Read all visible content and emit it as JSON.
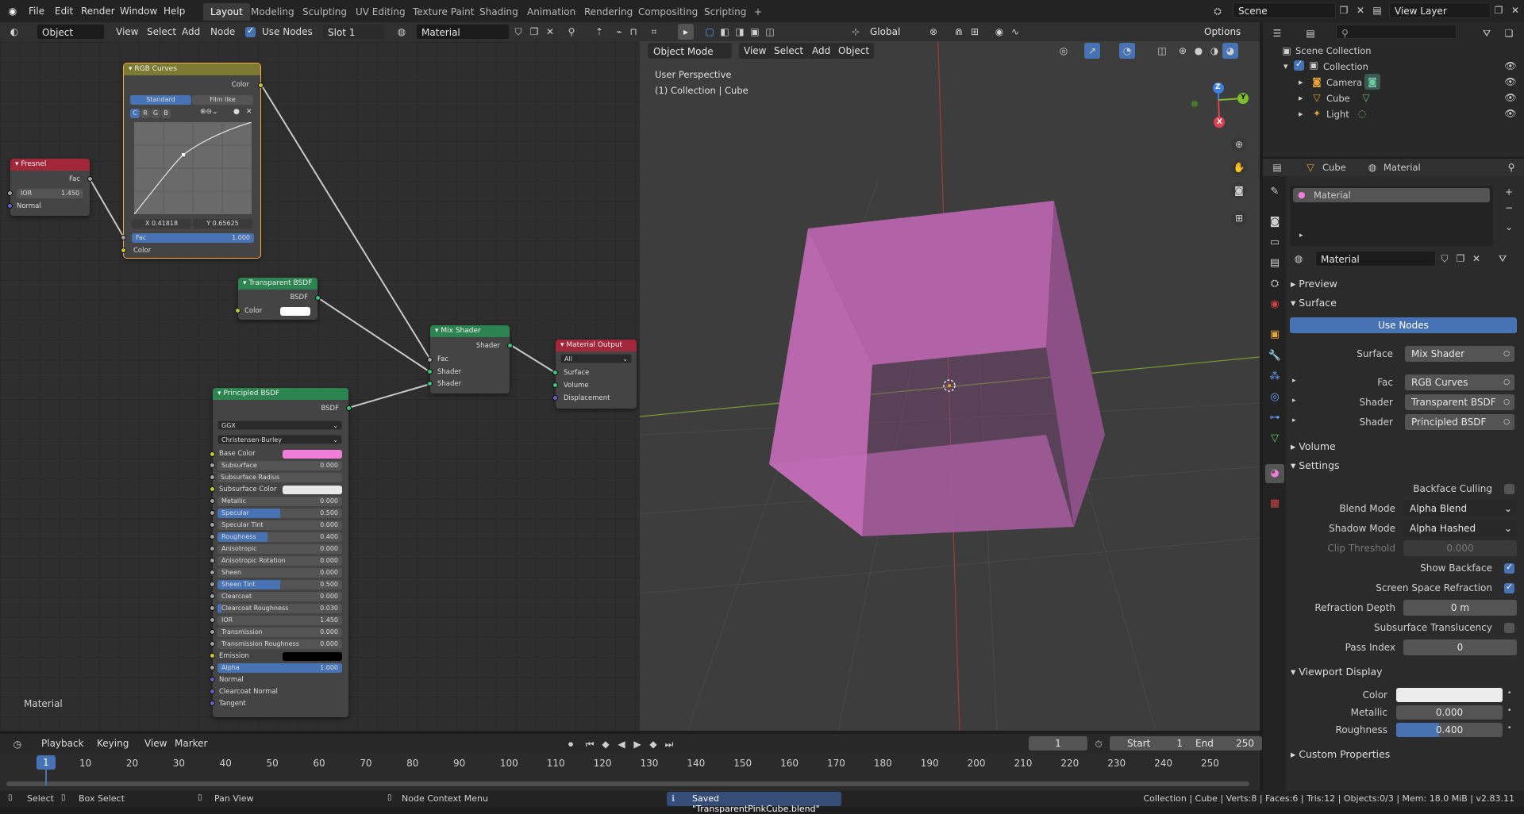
{
  "topbar": {
    "menus": [
      "File",
      "Edit",
      "Render",
      "Window",
      "Help"
    ],
    "workspaces": [
      "Layout",
      "Modeling",
      "Sculpting",
      "UV Editing",
      "Texture Paint",
      "Shading",
      "Animation",
      "Rendering",
      "Compositing",
      "Scripting"
    ],
    "active_workspace": "Layout",
    "add_tab": "+",
    "scene": "Scene",
    "view_layer": "View Layer"
  },
  "node_editor": {
    "header": {
      "mode": "Object",
      "view": "View",
      "select": "Select",
      "add": "Add",
      "node": "Node",
      "use_nodes": "Use Nodes",
      "slot": "Slot 1",
      "material": "Material"
    },
    "footer_label": "Material",
    "nodes": {
      "rgb_curves": {
        "title": "RGB Curves",
        "output": "Color",
        "tab_standard": "Standard",
        "tab_filmlike": "Film like",
        "channels": [
          "C",
          "R",
          "G",
          "B"
        ],
        "x_readout": "X 0.41818",
        "y_readout": "Y 0.65625",
        "fac_label": "Fac",
        "fac_value": "1.000",
        "input": "Color"
      },
      "fresnel": {
        "title": "Fresnel",
        "output": "Fac",
        "ior_label": "IOR",
        "ior_value": "1.450",
        "input": "Normal"
      },
      "transparent": {
        "title": "Transparent BSDF",
        "output": "BSDF",
        "color_label": "Color",
        "color": "#ffffff"
      },
      "mix": {
        "title": "Mix Shader",
        "output": "Shader",
        "inputs": [
          "Fac",
          "Shader",
          "Shader"
        ]
      },
      "output": {
        "title": "Material Output",
        "target": "All",
        "inputs": [
          "Surface",
          "Volume",
          "Displacement"
        ]
      },
      "principled": {
        "title": "Principled BSDF",
        "output": "BSDF",
        "distribution": "GGX",
        "subsurface_method": "Christensen-Burley",
        "base_color_label": "Base Color",
        "base_color": "#f07ed8",
        "fields": [
          {
            "label": "Subsurface",
            "value": "0.000",
            "frac": 0
          },
          {
            "label": "Subsurface Radius",
            "value": "",
            "frac": 0,
            "dropdown": true
          },
          {
            "label": "Subsurface Color",
            "value": "",
            "frac": 0,
            "color": "#e8e8e8"
          },
          {
            "label": "Metallic",
            "value": "0.000",
            "frac": 0
          },
          {
            "label": "Specular",
            "value": "0.500",
            "frac": 0.5
          },
          {
            "label": "Specular Tint",
            "value": "0.000",
            "frac": 0
          },
          {
            "label": "Roughness",
            "value": "0.400",
            "frac": 0.4
          },
          {
            "label": "Anisotropic",
            "value": "0.000",
            "frac": 0
          },
          {
            "label": "Anisotropic Rotation",
            "value": "0.000",
            "frac": 0
          },
          {
            "label": "Sheen",
            "value": "0.000",
            "frac": 0
          },
          {
            "label": "Sheen Tint",
            "value": "0.500",
            "frac": 0.5
          },
          {
            "label": "Clearcoat",
            "value": "0.000",
            "frac": 0
          },
          {
            "label": "Clearcoat Roughness",
            "value": "0.030",
            "frac": 0.03
          },
          {
            "label": "IOR",
            "value": "1.450",
            "frac": 0
          },
          {
            "label": "Transmission",
            "value": "0.000",
            "frac": 0
          },
          {
            "label": "Transmission Roughness",
            "value": "0.000",
            "frac": 0
          },
          {
            "label": "Emission",
            "value": "",
            "frac": 0,
            "color": "#000000"
          },
          {
            "label": "Alpha",
            "value": "1.000",
            "frac": 1
          },
          {
            "label": "Normal",
            "value": "",
            "frac": 0,
            "plain": true
          },
          {
            "label": "Clearcoat Normal",
            "value": "",
            "frac": 0,
            "plain": true
          },
          {
            "label": "Tangent",
            "value": "",
            "frac": 0,
            "plain": true
          }
        ]
      }
    }
  },
  "viewport": {
    "mode": "Object Mode",
    "menus": [
      "View",
      "Select",
      "Add",
      "Object"
    ],
    "transform": "Global",
    "options": "Options",
    "title": "User Perspective",
    "subtitle": "(1) Collection | Cube",
    "gizmo": {
      "x": "X",
      "y": "Y",
      "z": "Z"
    }
  },
  "outliner": {
    "root": "Scene Collection",
    "collection": "Collection",
    "items": [
      "Camera",
      "Cube",
      "Light"
    ]
  },
  "properties": {
    "object": "Cube",
    "material_tab": "Material",
    "slot_name": "Material",
    "material_name": "Material",
    "sections": {
      "preview": "Preview",
      "surface": "Surface",
      "volume": "Volume",
      "settings": "Settings",
      "viewport_display": "Viewport Display",
      "custom": "Custom Properties"
    },
    "use_nodes": "Use Nodes",
    "surface_rows": [
      {
        "label": "Surface",
        "value": "Mix Shader"
      },
      {
        "label": "Fac",
        "value": "RGB Curves"
      },
      {
        "label": "Shader",
        "value": "Transparent BSDF"
      },
      {
        "label": "Shader",
        "value": "Principled BSDF"
      }
    ],
    "settings": {
      "backface_culling": "Backface Culling",
      "blend_mode_label": "Blend Mode",
      "blend_mode": "Alpha Blend",
      "shadow_mode_label": "Shadow Mode",
      "shadow_mode": "Alpha Hashed",
      "clip_label": "Clip Threshold",
      "clip_value": "0.000",
      "show_backface": "Show Backface",
      "ssr": "Screen Space Refraction",
      "refr_depth_label": "Refraction Depth",
      "refr_depth": "0 m",
      "sss_trans": "Subsurface Translucency",
      "pass_index_label": "Pass Index",
      "pass_index": "0"
    },
    "viewport_display": {
      "color_label": "Color",
      "color": "#ececec",
      "metallic_label": "Metallic",
      "metallic": "0.000",
      "metallic_frac": 0,
      "roughness_label": "Roughness",
      "roughness": "0.400",
      "roughness_frac": 0.4
    }
  },
  "timeline": {
    "menus": [
      "Playback",
      "Keying",
      "View",
      "Marker"
    ],
    "current_frame": "1",
    "start_label": "Start",
    "start": "1",
    "end_label": "End",
    "end": "250",
    "ticks": [
      "1",
      "10",
      "20",
      "30",
      "40",
      "50",
      "60",
      "70",
      "80",
      "90",
      "100",
      "110",
      "120",
      "130",
      "140",
      "150",
      "160",
      "170",
      "180",
      "190",
      "200",
      "210",
      "220",
      "230",
      "240",
      "250"
    ]
  },
  "status": {
    "select": "Select",
    "box_select": "Box Select",
    "pan": "Pan View",
    "context": "Node Context Menu",
    "saved": "Saved \"TransparentPinkCube.blend\"",
    "stats": "Collection | Cube | Verts:8 | Faces:6 | Tris:12 | Objects:0/3 | Mem: 18.0 MiB | v2.83.11"
  },
  "colors": {
    "accent": "#4772b3",
    "cube": "#b560a8",
    "node_shader": "#2c8550",
    "node_color": "#a7a02f",
    "node_input": "#b22e3c",
    "node_output": "#b22e3c"
  }
}
